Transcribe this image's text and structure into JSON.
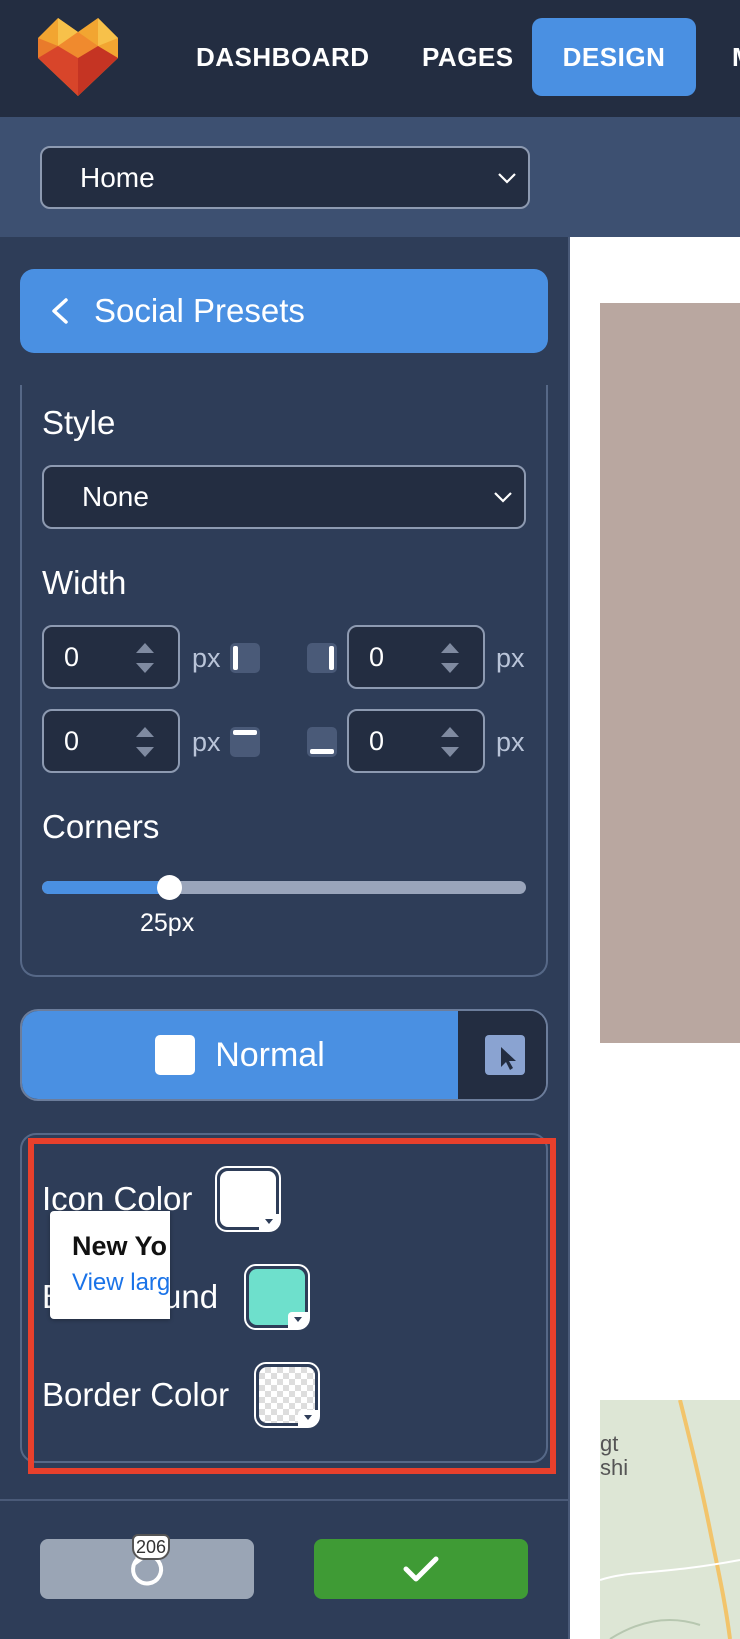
{
  "nav": {
    "items": [
      {
        "label": "DASHBOARD"
      },
      {
        "label": "PAGES"
      },
      {
        "label": "DESIGN",
        "active": true
      },
      {
        "label": "M"
      }
    ],
    "accent": "#4a90e2"
  },
  "page_selector": {
    "value": "Home"
  },
  "panel": {
    "back_label": "Social Presets",
    "style_label": "Style",
    "style_value": "None",
    "width_label": "Width",
    "width": {
      "left": "0",
      "right": "0",
      "top": "0",
      "bottom": "0",
      "unit": "px"
    },
    "corners_label": "Corners",
    "corners_value": "25px",
    "corners_fraction": 0.25
  },
  "state_toggle": {
    "normal_label": "Normal"
  },
  "colors": {
    "icon_color_label": "Icon Color",
    "icon_color": "#ffffff",
    "background_label": "Background",
    "background_color": "#6ee0cc",
    "border_color_label": "Border Color",
    "border_color": "transparent"
  },
  "preview": {
    "map_title": "New Yo",
    "map_link": "View larg",
    "map_side_text_1": "gt",
    "map_side_text_2": "shi",
    "map_shield": "206"
  }
}
